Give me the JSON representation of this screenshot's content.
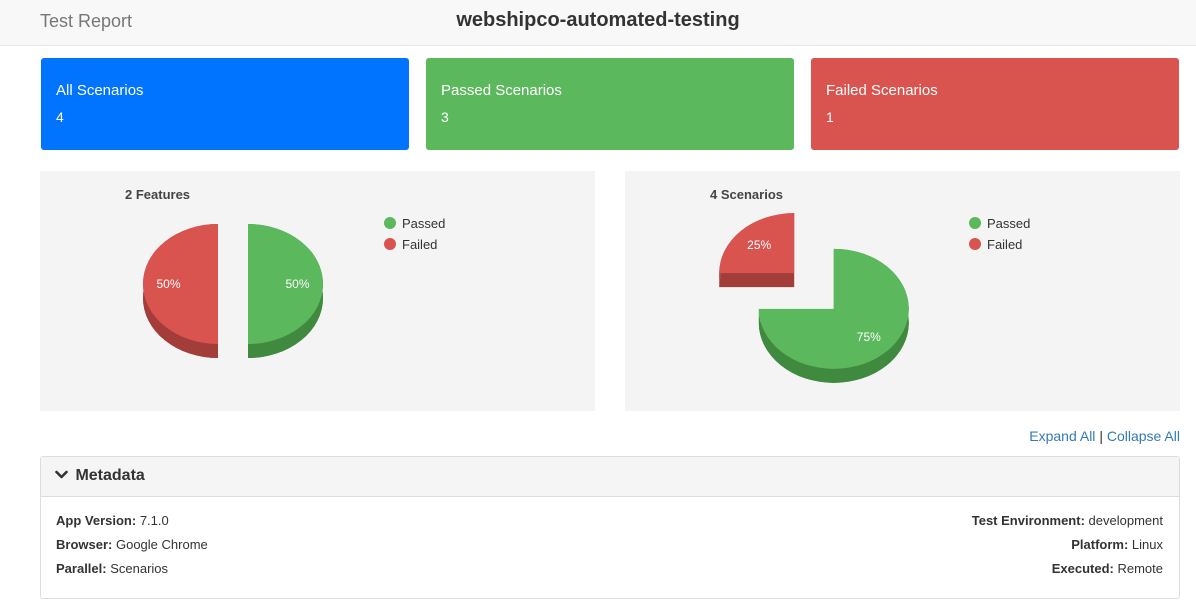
{
  "header": {
    "brand": "Test Report",
    "title": "webshipco-automated-testing"
  },
  "cards": {
    "all": {
      "label": "All Scenarios",
      "value": "4"
    },
    "passed": {
      "label": "Passed Scenarios",
      "value": "3"
    },
    "failed": {
      "label": "Failed Scenarios",
      "value": "1"
    }
  },
  "colors": {
    "passed": "#5cb85c",
    "failed": "#d9534f",
    "all": "#0073ff"
  },
  "chart_data": [
    {
      "type": "pie",
      "title": "2 Features",
      "categories": [
        "Passed",
        "Failed"
      ],
      "values": [
        50,
        50
      ],
      "labels": [
        "50%",
        "50%"
      ],
      "legend_position": "top-right",
      "exploded": true,
      "three_d": true
    },
    {
      "type": "pie",
      "title": "4 Scenarios",
      "categories": [
        "Passed",
        "Failed"
      ],
      "values": [
        75,
        25
      ],
      "labels": [
        "75%",
        "25%"
      ],
      "legend_position": "top-right",
      "exploded": true,
      "three_d": true
    }
  ],
  "toggles": {
    "expand": "Expand All",
    "separator": "|",
    "collapse": "Collapse All"
  },
  "metadata": {
    "heading": "Metadata",
    "left": [
      {
        "key": "App Version:",
        "value": "7.1.0"
      },
      {
        "key": "Browser:",
        "value": "Google Chrome"
      },
      {
        "key": "Parallel:",
        "value": "Scenarios"
      }
    ],
    "right": [
      {
        "key": "Test Environment:",
        "value": "development"
      },
      {
        "key": "Platform:",
        "value": "Linux"
      },
      {
        "key": "Executed:",
        "value": "Remote"
      }
    ]
  }
}
